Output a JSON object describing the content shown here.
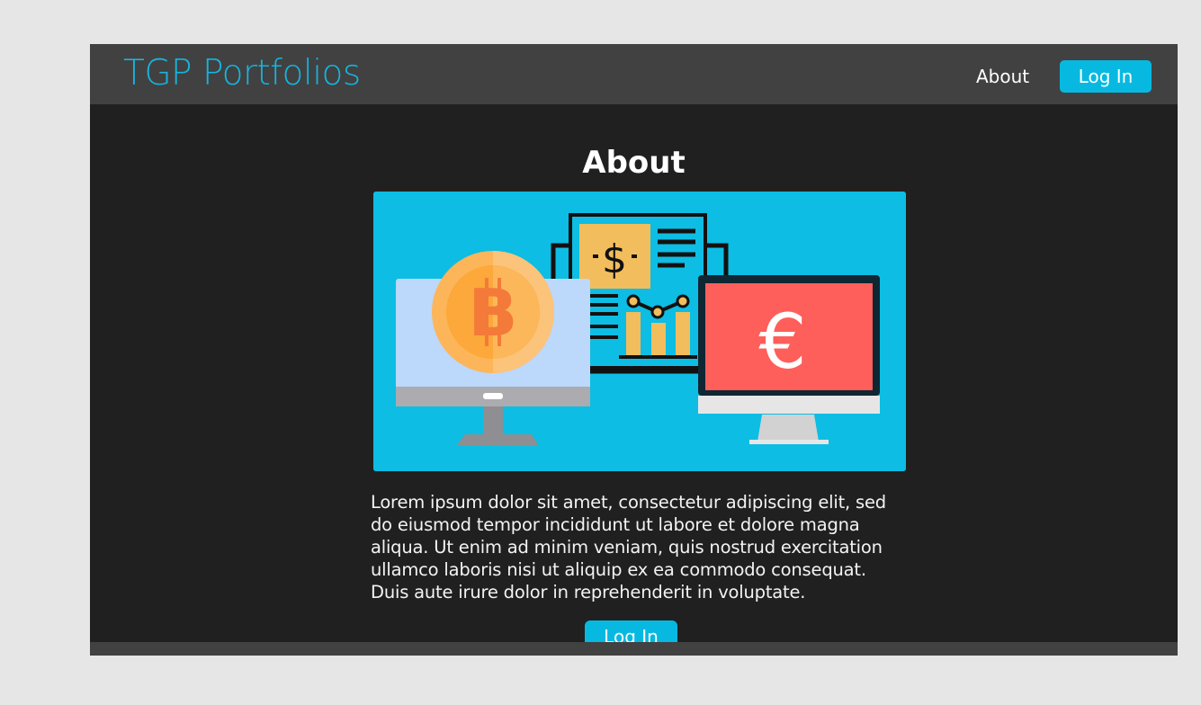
{
  "brand": {
    "name": "TGP Portfolios"
  },
  "nav": {
    "about_label": "About",
    "login_label": "Log In"
  },
  "main": {
    "title": "About",
    "hero_currency_dollar": "$",
    "hero_currency_bitcoin": "B",
    "hero_currency_euro": "€",
    "body": "Lorem ipsum dolor sit amet, consectetur adipiscing elit, sed do eiusmod tempor incididunt ut labore et dolore magna aliqua. Ut enim ad minim veniam, quis nostrud exercitation ullamco laboris nisi ut aliquip ex ea commodo consequat. Duis aute irure dolor in reprehenderit in voluptate.",
    "cta_label": "Log In"
  },
  "colors": {
    "accent": "#07b9e1",
    "brand_text": "#17b4de",
    "navbar_bg": "#414141",
    "content_bg": "#202020",
    "page_bg": "#e6e6e6"
  },
  "icons": {
    "hero": "finance-illustration",
    "monitor_left": "bitcoin-monitor-icon",
    "document": "dollar-report-icon",
    "monitor_right": "euro-monitor-icon"
  }
}
